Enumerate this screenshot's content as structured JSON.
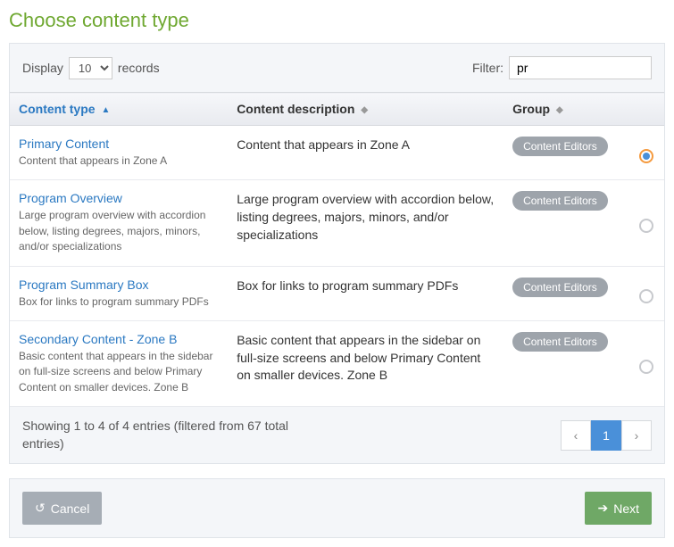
{
  "title": "Choose content type",
  "display": {
    "label_before": "Display",
    "value": "10",
    "label_after": "records"
  },
  "filter": {
    "label": "Filter:",
    "value": "pr"
  },
  "columns": {
    "type": "Content type",
    "desc": "Content description",
    "group": "Group"
  },
  "rows": [
    {
      "name": "Primary Content",
      "sub": "Content that appears in Zone A",
      "desc": "Content that appears in Zone A",
      "group": "Content Editors",
      "selected": true
    },
    {
      "name": "Program Overview",
      "sub": "Large program overview with accordion below, listing degrees, majors, minors, and/or specializations",
      "desc": "Large program overview with accordion below, listing degrees, majors, minors, and/or specializations",
      "group": "Content Editors",
      "selected": false
    },
    {
      "name": "Program Summary Box",
      "sub": "Box for links to program summary PDFs",
      "desc": "Box for links to program summary PDFs",
      "group": "Content Editors",
      "selected": false
    },
    {
      "name": "Secondary Content - Zone B",
      "sub": "Basic content that appears in the sidebar on full-size screens and below Primary Content on smaller devices. Zone B",
      "desc": "Basic content that appears in the sidebar on full-size screens and below Primary Content on smaller devices. Zone B",
      "group": "Content Editors",
      "selected": false
    }
  ],
  "showing": "Showing 1 to 4 of 4 entries (filtered from 67 total entries)",
  "pager": {
    "prev": "‹",
    "page": "1",
    "next": "›"
  },
  "buttons": {
    "cancel": "Cancel",
    "next": "Next"
  },
  "icons": {
    "undo": "↺",
    "arrow": "➔",
    "sort_asc": "▲",
    "sort_both": "◆"
  }
}
